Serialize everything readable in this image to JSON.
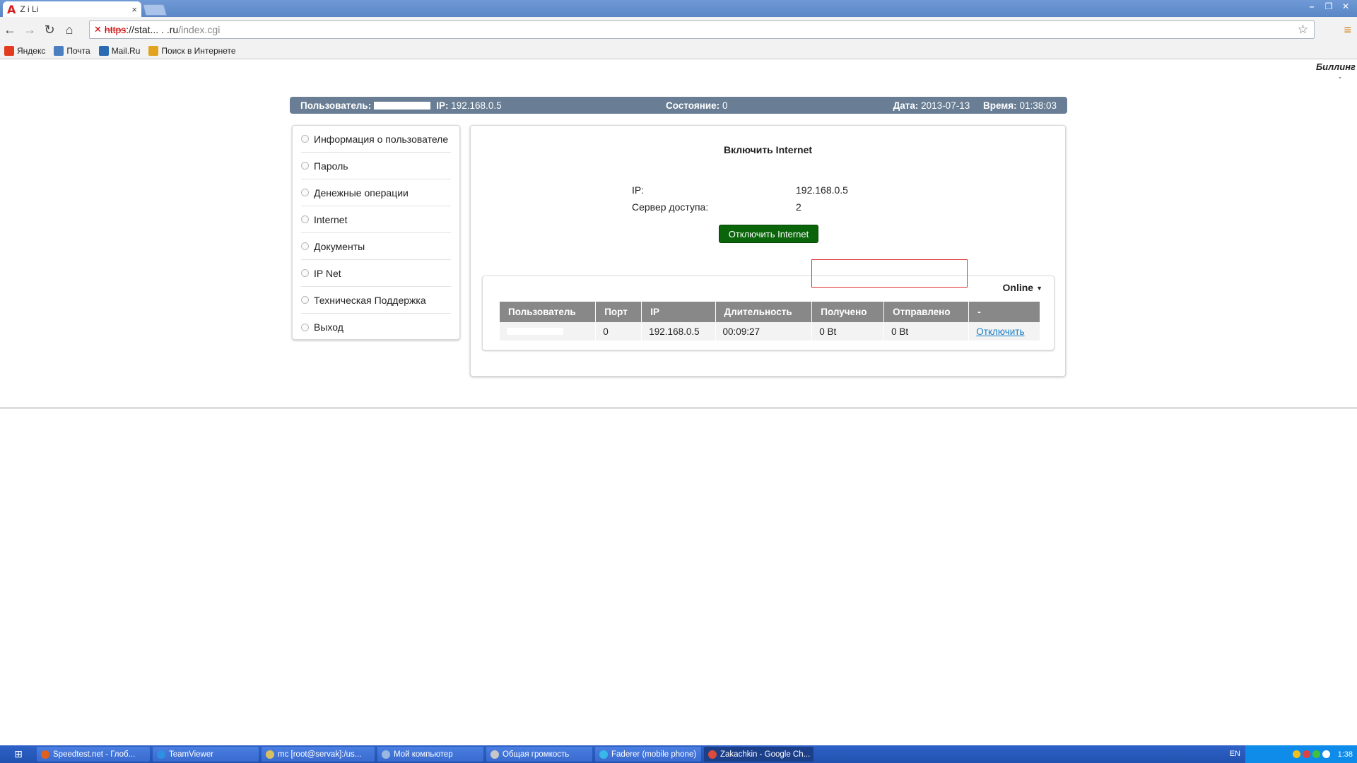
{
  "browser": {
    "tab_title": "Z i   Li",
    "tab_close": "×",
    "url_scheme": "https",
    "url_host_sep": "://",
    "url_host": "stat...  .  .ru",
    "url_path": "/index.cgi",
    "bookmarks": [
      {
        "label": "Яндекс",
        "icon": "yandex-icon",
        "color": "#e23b1e"
      },
      {
        "label": "Почта",
        "icon": "mail-icon",
        "color": "#4a7fc0"
      },
      {
        "label": "Mail.Ru",
        "icon": "mailru-icon",
        "color": "#2a6bb2"
      },
      {
        "label": "Поиск в Интернете",
        "icon": "search-icon",
        "color": "#e2a31e"
      }
    ]
  },
  "page": {
    "corner_brand": "Биллинг",
    "corner_dash": "-",
    "status": {
      "user_label": "Пользователь:",
      "ip_label": "IP:",
      "ip_value": "192.168.0.5",
      "state_label": "Состояние:",
      "state_value": "0",
      "date_label": "Дата:",
      "date_value": "2013-07-13",
      "time_label": "Время:",
      "time_value": "01:38:03"
    },
    "menu": [
      "Информация о пользователе",
      "Пароль",
      "Денежные операции",
      "Internet",
      "Документы",
      "IP Net",
      "Техническая Поддержка",
      "Выход"
    ],
    "panel": {
      "title": "Включить Internet",
      "ip_label": "IP:",
      "ip_value": "192.168.0.5",
      "server_label": "Сервер доступа:",
      "server_value": "2",
      "disconnect_button": "Отключить Internet"
    },
    "online": {
      "toggle_label": "Online",
      "columns": [
        "Пользователь",
        "Порт",
        "IP",
        "Длительность",
        "Получено",
        "Отправлено",
        "-"
      ],
      "rows": [
        {
          "user": "",
          "port": "0",
          "ip": "192.168.0.5",
          "duration": "00:09:27",
          "received": "0 Bt",
          "sent": "0 Bt",
          "action": "Отключить"
        }
      ]
    }
  },
  "taskbar": {
    "items": [
      {
        "label": "Speedtest.net - Глоб...",
        "color": "#e0601c"
      },
      {
        "label": "TeamViewer",
        "color": "#2f8fe0"
      },
      {
        "label": "mc [root@servak]:/us...",
        "color": "#d8c060"
      },
      {
        "label": "Мой компьютер",
        "color": "#9ab8e0"
      },
      {
        "label": "Общая громкость",
        "color": "#c8c8c8"
      },
      {
        "label": "Faderer (mobile phone)",
        "color": "#38b8e8"
      },
      {
        "label": "Zakachkin - Google Ch...",
        "color": "#dd4b39"
      }
    ],
    "lang": "EN",
    "clock": "1:38"
  }
}
